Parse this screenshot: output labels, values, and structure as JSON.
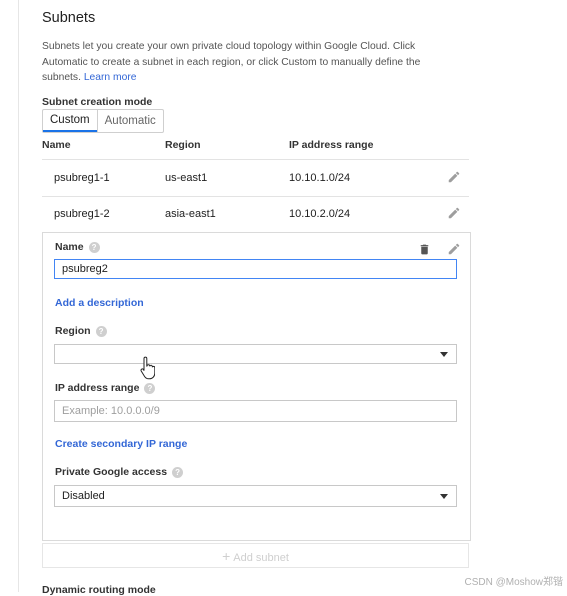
{
  "section": {
    "title": "Subnets",
    "description": "Subnets let you create your own private cloud topology within Google Cloud. Click Automatic to create a subnet in each region, or click Custom to manually define the subnets.",
    "learn_more": "Learn more"
  },
  "mode": {
    "label": "Subnet creation mode",
    "options": [
      "Custom",
      "Automatic"
    ],
    "selected": "Custom"
  },
  "table": {
    "headers": [
      "Name",
      "Region",
      "IP address range"
    ],
    "rows": [
      {
        "name": "psubreg1-1",
        "region": "us-east1",
        "ip": "10.10.1.0/24"
      },
      {
        "name": "psubreg1-2",
        "region": "asia-east1",
        "ip": "10.10.2.0/24"
      }
    ]
  },
  "form": {
    "name_label": "Name",
    "name_value": "psubreg2",
    "add_description": "Add a description",
    "region_label": "Region",
    "region_value": "",
    "ip_label": "IP address range",
    "ip_placeholder": "Example: 10.0.0.0/9",
    "secondary_link": "Create secondary IP range",
    "private_label": "Private Google access",
    "private_value": "Disabled"
  },
  "add_subnet": "Add subnet",
  "next_section_label": "Dynamic routing mode",
  "watermark": "CSDN @Moshow郑锴",
  "icons": {
    "edit": "pencil-icon",
    "delete": "trash-icon",
    "help": "question-circle-icon",
    "dropdown": "caret-down-icon",
    "cursor": "hand-pointer-cursor"
  }
}
